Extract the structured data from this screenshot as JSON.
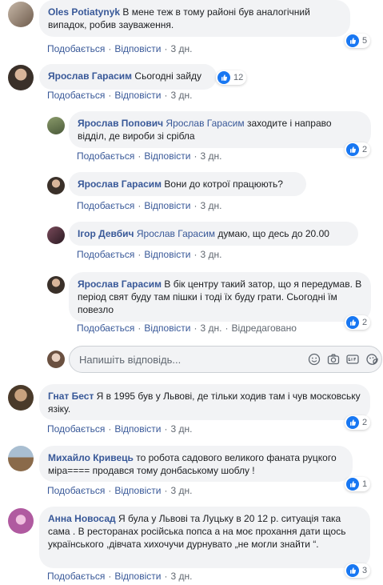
{
  "actions": {
    "like": "Подобається",
    "reply": "Відповісти"
  },
  "comments": [
    {
      "author": "Oles Potiatynyk",
      "text": "В мене теж в тому районі був аналогічний випадок, робив зауваження.",
      "time": "3 дн.",
      "reactions": "5"
    },
    {
      "author": "Ярослав Гарасим",
      "text": "Сьогодні зайду",
      "time": "3 дн.",
      "reactions": "12",
      "replies": [
        {
          "author": "Ярослав Попович",
          "mention": "Ярослав Гарасим",
          "text": "заходите і направо відділ, де вироби зі срібла",
          "time": "3 дн.",
          "reactions": "2"
        },
        {
          "author": "Ярослав Гарасим",
          "text": "Вони до котрої працюють?",
          "time": "3 дн."
        },
        {
          "author": "Ігор Девбич",
          "mention": "Ярослав Гарасим",
          "text": "думаю, що десь до 20.00",
          "time": "3 дн."
        },
        {
          "author": "Ярослав Гарасим",
          "text": "В бік центру такий затор, що я передумав. В період свят буду там пішки і тоді їх буду грати. Сьогодні їм повезло",
          "time": "3 дн.",
          "edited": "Відредаговано",
          "reactions": "2"
        }
      ],
      "reply_placeholder": "Напишіть відповідь..."
    },
    {
      "author": "Гнат Бест",
      "text": "Я в 1995 був у Львові, де тільки ходив там і чув московську язіку.",
      "time": "3 дн.",
      "reactions": "2"
    },
    {
      "author": "Михайло Кривець",
      "text": "то робота садового великого фаната руцкого міра==== продався тому донбаському шоблу !",
      "time": "3 дн.",
      "reactions": "1"
    },
    {
      "author": "Анна Новосад",
      "text": "Я була у Львові та Луцьку в 20 12 р. ситуація така сама . В ресторанах російська попса а на моє прохання дати щось українського ,дівчата хихочучи дурнувато „не могли знайти “.",
      "time": "3 дн.",
      "reactions": "3"
    }
  ],
  "colors": {
    "link": "#385898",
    "bubble": "#f2f3f5",
    "like": "#1877f2",
    "meta": "#606770"
  }
}
